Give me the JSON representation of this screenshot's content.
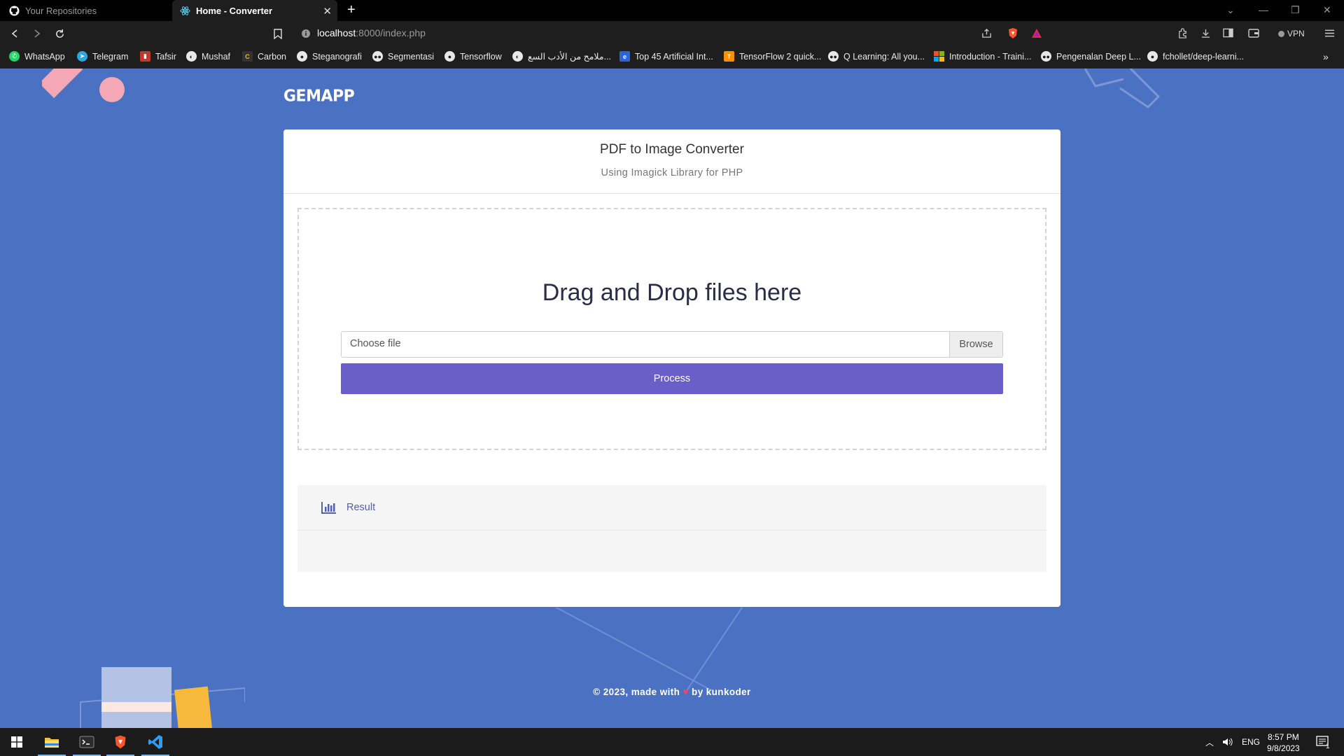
{
  "browser": {
    "tabs": [
      {
        "title": "Your Repositories",
        "icon": "github-icon",
        "active": false
      },
      {
        "title": "Home - Converter",
        "icon": "react-icon",
        "active": true
      }
    ],
    "url": {
      "host": "localhost",
      "rest": ":8000/index.php"
    },
    "vpn_label": "VPN",
    "bookmarks": [
      {
        "label": "WhatsApp",
        "icon": "whatsapp-icon",
        "color": "#25d366"
      },
      {
        "label": "Telegram",
        "icon": "telegram-icon",
        "color": "#2ea6de"
      },
      {
        "label": "Tafsir",
        "icon": "book-icon",
        "color": "#c0392b"
      },
      {
        "label": "Mushaf",
        "icon": "globe-icon",
        "color": "#555555"
      },
      {
        "label": "Carbon",
        "icon": "carbon-icon",
        "color": "#333333"
      },
      {
        "label": "Steganografi",
        "icon": "github-icon",
        "color": "#333333"
      },
      {
        "label": "Segmentasi",
        "icon": "medium-icon",
        "color": "#111111"
      },
      {
        "label": "Tensorflow",
        "icon": "github-icon",
        "color": "#333333"
      },
      {
        "label": "ملامح من الأدب السع...",
        "icon": "globe-icon",
        "color": "#555555"
      },
      {
        "label": "Top 45 Artificial Int...",
        "icon": "edge-icon",
        "color": "#2a66d9"
      },
      {
        "label": "TensorFlow 2 quick...",
        "icon": "tensorflow-icon",
        "color": "#ff8f00"
      },
      {
        "label": "Q Learning: All you...",
        "icon": "medium-icon",
        "color": "#111111"
      },
      {
        "label": "Introduction - Traini...",
        "icon": "microsoft-icon",
        "color": "#f25022"
      },
      {
        "label": "Pengenalan Deep L...",
        "icon": "medium-icon",
        "color": "#111111"
      },
      {
        "label": "fchollet/deep-learni...",
        "icon": "github-icon",
        "color": "#333333"
      }
    ]
  },
  "app": {
    "brand": "GEMAPP",
    "title": "PDF to Image Converter",
    "subtitle": "Using Imagick Library for PHP",
    "dropzone_title": "Drag and Drop files here",
    "file_placeholder": "Choose file",
    "browse_label": "Browse",
    "process_label": "Process",
    "result_label": "Result",
    "footer": {
      "prefix": "© 2023, made with",
      "suffix": "by kunkoder"
    }
  },
  "taskbar": {
    "apps": [
      "windows-start-icon",
      "file-explorer-icon",
      "terminal-icon",
      "brave-icon",
      "vscode-icon"
    ],
    "language": "ENG",
    "time": "8:57 PM",
    "date": "9/8/2023",
    "notification_count": "1"
  },
  "colors": {
    "page_bg": "#4b71c2",
    "accent": "#6a5fc9",
    "card_bg": "#ffffff"
  }
}
